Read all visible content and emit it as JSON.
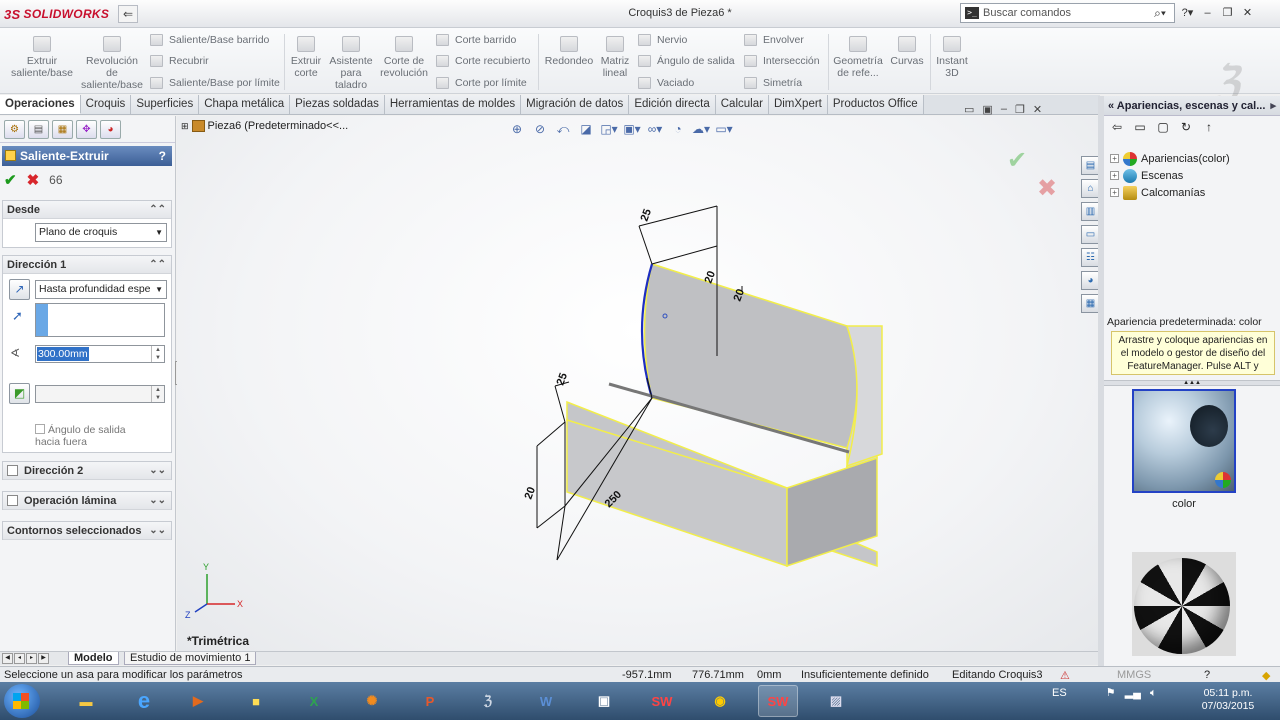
{
  "app": {
    "logo": "SOLIDWORKS",
    "window_title": "Croquis3 de Pieza6 *",
    "search_placeholder": "Buscar comandos"
  },
  "ribbon": {
    "large_buttons": [
      {
        "id": "extrude-boss",
        "label": "Extruir saliente/base"
      },
      {
        "id": "revolve-boss",
        "label": "Revolución de saliente/base"
      },
      {
        "id": "extrude-cut",
        "label": "Extruir corte"
      },
      {
        "id": "hole-wizard",
        "label": "Asistente para taladro"
      },
      {
        "id": "revolve-cut",
        "label": "Corte de revolución"
      },
      {
        "id": "fillet",
        "label": "Redondeo"
      },
      {
        "id": "linear-pattern",
        "label": "Matriz lineal"
      },
      {
        "id": "reference-geometry",
        "label": "Geometría de refe..."
      },
      {
        "id": "curves",
        "label": "Curvas"
      },
      {
        "id": "instant3d",
        "label": "Instant 3D"
      }
    ],
    "small_buttons": [
      {
        "id": "swept-boss",
        "label": "Saliente/Base barrido"
      },
      {
        "id": "loft-boss",
        "label": "Recubrir"
      },
      {
        "id": "boundary-boss",
        "label": "Saliente/Base por límite"
      },
      {
        "id": "swept-cut",
        "label": "Corte barrido"
      },
      {
        "id": "lofted-cut",
        "label": "Corte recubierto"
      },
      {
        "id": "boundary-cut",
        "label": "Corte por límite"
      },
      {
        "id": "rib",
        "label": "Nervio"
      },
      {
        "id": "draft",
        "label": "Ángulo de salida"
      },
      {
        "id": "shell",
        "label": "Vaciado"
      },
      {
        "id": "wrap",
        "label": "Envolver"
      },
      {
        "id": "intersect",
        "label": "Intersección"
      },
      {
        "id": "mirror",
        "label": "Simetría"
      }
    ]
  },
  "tabs": [
    "Operaciones",
    "Croquis",
    "Superficies",
    "Chapa metálica",
    "Piezas soldadas",
    "Herramientas de moldes",
    "Migración de datos",
    "Edición directa",
    "Calcular",
    "DimXpert",
    "Productos Office"
  ],
  "property_manager": {
    "title": "Saliente-Extruir",
    "help": "?",
    "from_header": "Desde",
    "from_value": "Plano de croquis",
    "dir1_header": "Dirección 1",
    "end_condition": "Hasta profundidad espe",
    "depth_value": "300.00mm",
    "draft_label": "Ángulo de salida hacia fuera",
    "dir2_header": "Dirección 2",
    "thin_header": "Operación lámina",
    "contours_header": "Contornos seleccionados"
  },
  "viewport": {
    "tree_root": "Pieza6  (Predeterminado<<...",
    "view_name": "*Trimétrica",
    "dimensions": [
      "25",
      "20",
      "20",
      "25",
      "20",
      "250"
    ],
    "axis_labels": {
      "x": "X",
      "y": "Y",
      "z": "Z"
    }
  },
  "bottom_tabs": [
    "Modelo",
    "Estudio de movimiento 1"
  ],
  "task_pane": {
    "header": "Apariencias, escenas y cal...",
    "tree": [
      {
        "label": "Apariencias(color)",
        "icon": "appearance-icon"
      },
      {
        "label": "Escenas",
        "icon": "scenes-icon"
      },
      {
        "label": "Calcomanías",
        "icon": "decals-icon"
      }
    ],
    "default_label": "Apariencia predeterminada: color",
    "tooltip": "Arrastre y coloque apariencias en el modelo o gestor de diseño del FeatureManager. Pulse ALT y arra...",
    "thumbnail_label": "color"
  },
  "status_bar": {
    "message": "Seleccione un asa para modificar los parámetros",
    "x": "-957.1mm",
    "y": "776.71mm",
    "z": "0mm",
    "state": "Insuficientemente definido",
    "mode": "Editando Croquis3",
    "units": "MMGS",
    "help": "?"
  },
  "taskbar": {
    "lang": "ES",
    "time": "05:11 p.m.",
    "date": "07/03/2015"
  },
  "colors": {
    "solid_yellow_edge": "#f6f060",
    "solid_face": "#b8b9bd",
    "ok_green": "#1d9a1d",
    "cancel_red": "#d8262c",
    "title_blue": "#3c5f96"
  }
}
